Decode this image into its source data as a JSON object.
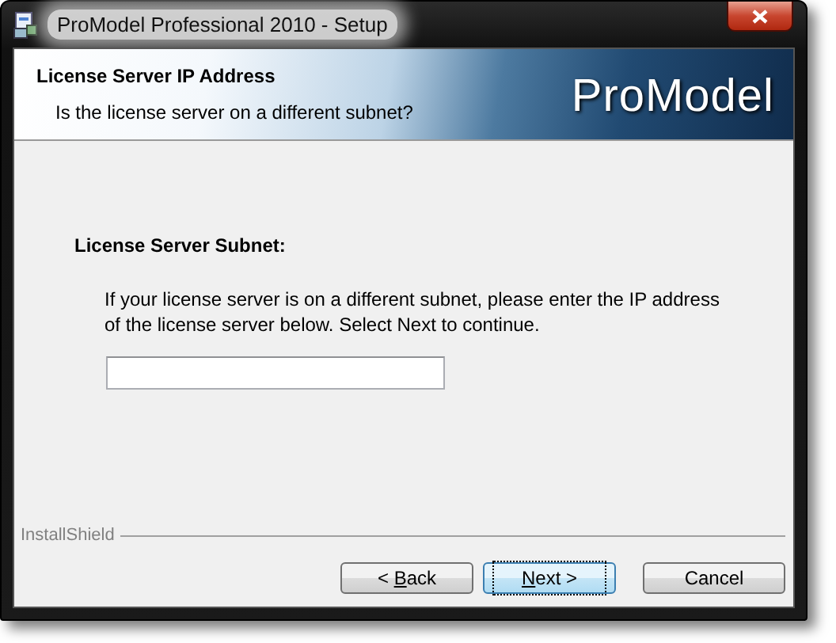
{
  "window": {
    "title": "ProModel Professional 2010 - Setup"
  },
  "header": {
    "title": "License Server IP Address",
    "subtitle": "Is the license server on a different subnet?",
    "logo": "ProModel"
  },
  "body": {
    "heading": "License Server Subnet:",
    "instructions": "If your license server is on a different subnet, please enter the IP address of the license server below. Select Next to continue."
  },
  "footer": {
    "brand": "InstallShield"
  },
  "buttons": [
    {
      "before": "< ",
      "mnemonic": "B",
      "after": "ack",
      "default": false
    },
    {
      "mnemonic": "N",
      "after": "ext >",
      "default": true
    },
    {
      "before": "Cancel",
      "default": false
    }
  ]
}
